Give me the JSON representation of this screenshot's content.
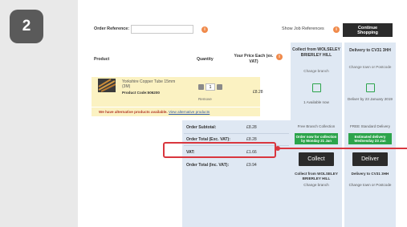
{
  "step": "2",
  "order_ref": {
    "label": "Order Reference:",
    "value": ""
  },
  "show_job": "Show Job References",
  "continue_label": "Continue Shopping",
  "info_glyph": "i",
  "headers": {
    "product": "Product",
    "quantity": "Quantity",
    "price": "Your Price Each (ex. VAT)",
    "collect_title": "Collect from WOLSELEY BRIERLEY HILL",
    "collect_sub": "Change branch",
    "delivery_title": "Delivery to CV31 3HH",
    "delivery_sub": "Change town or Postcode"
  },
  "item": {
    "name": "Yorkshire Copper Tube 15mm (3M)",
    "code": "Product Code:506200",
    "qty": "1",
    "remove": "Remove",
    "price": "£8.28",
    "available": "1 Available now",
    "delivery_by": "Deliver by 23 January 2019"
  },
  "alt": {
    "text": "We have alternative products available.",
    "link": "View alternative products"
  },
  "summary": {
    "subtotal_label": "Order Subtotal:",
    "subtotal": "£8.28",
    "total_ex_label": "Order Total (Exc. VAT):",
    "total_ex": "£8.28",
    "vat_label": "VAT:",
    "vat": "£1.66",
    "total_inc_label": "Order Total (Inc. VAT):",
    "total_inc": "£9.94"
  },
  "collect": {
    "free": "Free Branch Collection",
    "pill": "Order now for collection by Monday 21 Jan",
    "button": "Collect",
    "from": "Collect from WOLSELEY BRIERLEY HILL",
    "change": "Change branch"
  },
  "delivery": {
    "free": "FREE Standard Delivery",
    "pill": "Estimated delivery Wednesday 23 Jan",
    "button": "Deliver",
    "to": "Delivery to CV31 3HH",
    "change": "Change town or Postcode"
  },
  "colors": {
    "accent_red": "#d9363e",
    "green": "#2ca44b",
    "orange": "#f08a4b",
    "panel_blue": "#dfe8f3",
    "item_yellow": "#fbf2c2"
  }
}
